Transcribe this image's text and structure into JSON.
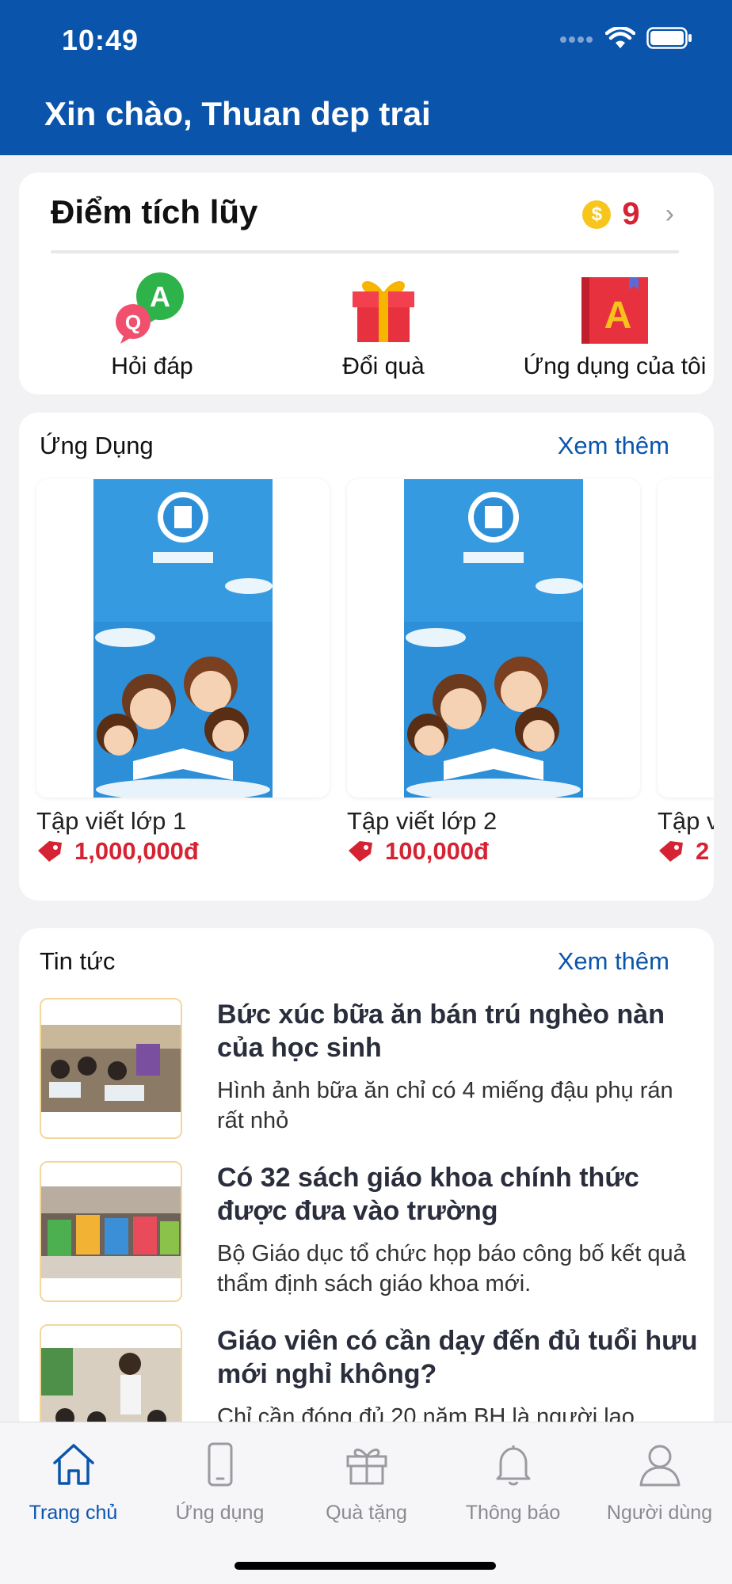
{
  "status_bar": {
    "time": "10:49"
  },
  "header": {
    "greeting": "Xin chào, Thuan dep trai"
  },
  "points": {
    "title": "Điểm tích lũy",
    "coin_symbol": "$",
    "value": "9",
    "actions": [
      {
        "label": "Hỏi đáp",
        "icon": "qa-bubbles-icon"
      },
      {
        "label": "Đổi quà",
        "icon": "gift-box-icon"
      },
      {
        "label": "Ứng dụng của tôi",
        "icon": "red-book-icon"
      }
    ]
  },
  "apps": {
    "title": "Ứng Dụng",
    "see_more": "Xem thêm",
    "items": [
      {
        "name": "Tập viết lớp 1",
        "price": "1,000,000đ"
      },
      {
        "name": "Tập viết lớp 2",
        "price": "100,000đ"
      },
      {
        "name": "Tập v",
        "price": "2"
      }
    ]
  },
  "news": {
    "title": "Tin tức",
    "see_more": "Xem thêm",
    "items": [
      {
        "title": "Bức xúc bữa ăn bán trú nghèo nàn của học sinh",
        "desc": "Hình ảnh bữa ăn chỉ có 4 miếng đậu phụ rán rất nhỏ"
      },
      {
        "title": "Có 32 sách giáo khoa chính thức được đưa vào trường",
        "desc": "Bộ Giáo dục tổ chức họp báo công bố kết quả thẩm định sách giáo khoa mới."
      },
      {
        "title": "Giáo viên có cần dạy đến đủ tuổi hưu mới nghỉ không?",
        "desc": "Chỉ cần đóng đủ 20 năm BH là người lao"
      }
    ]
  },
  "tabbar": {
    "tabs": [
      {
        "label": "Trang chủ",
        "icon": "home-icon",
        "active": true
      },
      {
        "label": "Ứng dụng",
        "icon": "phone-icon",
        "active": false
      },
      {
        "label": "Quà tặng",
        "icon": "gift-icon",
        "active": false
      },
      {
        "label": "Thông báo",
        "icon": "bell-icon",
        "active": false
      },
      {
        "label": "Người dùng",
        "icon": "user-icon",
        "active": false
      }
    ]
  },
  "colors": {
    "primary": "#0a55ab",
    "price_red": "#d62333",
    "coin": "#f8c51c"
  }
}
